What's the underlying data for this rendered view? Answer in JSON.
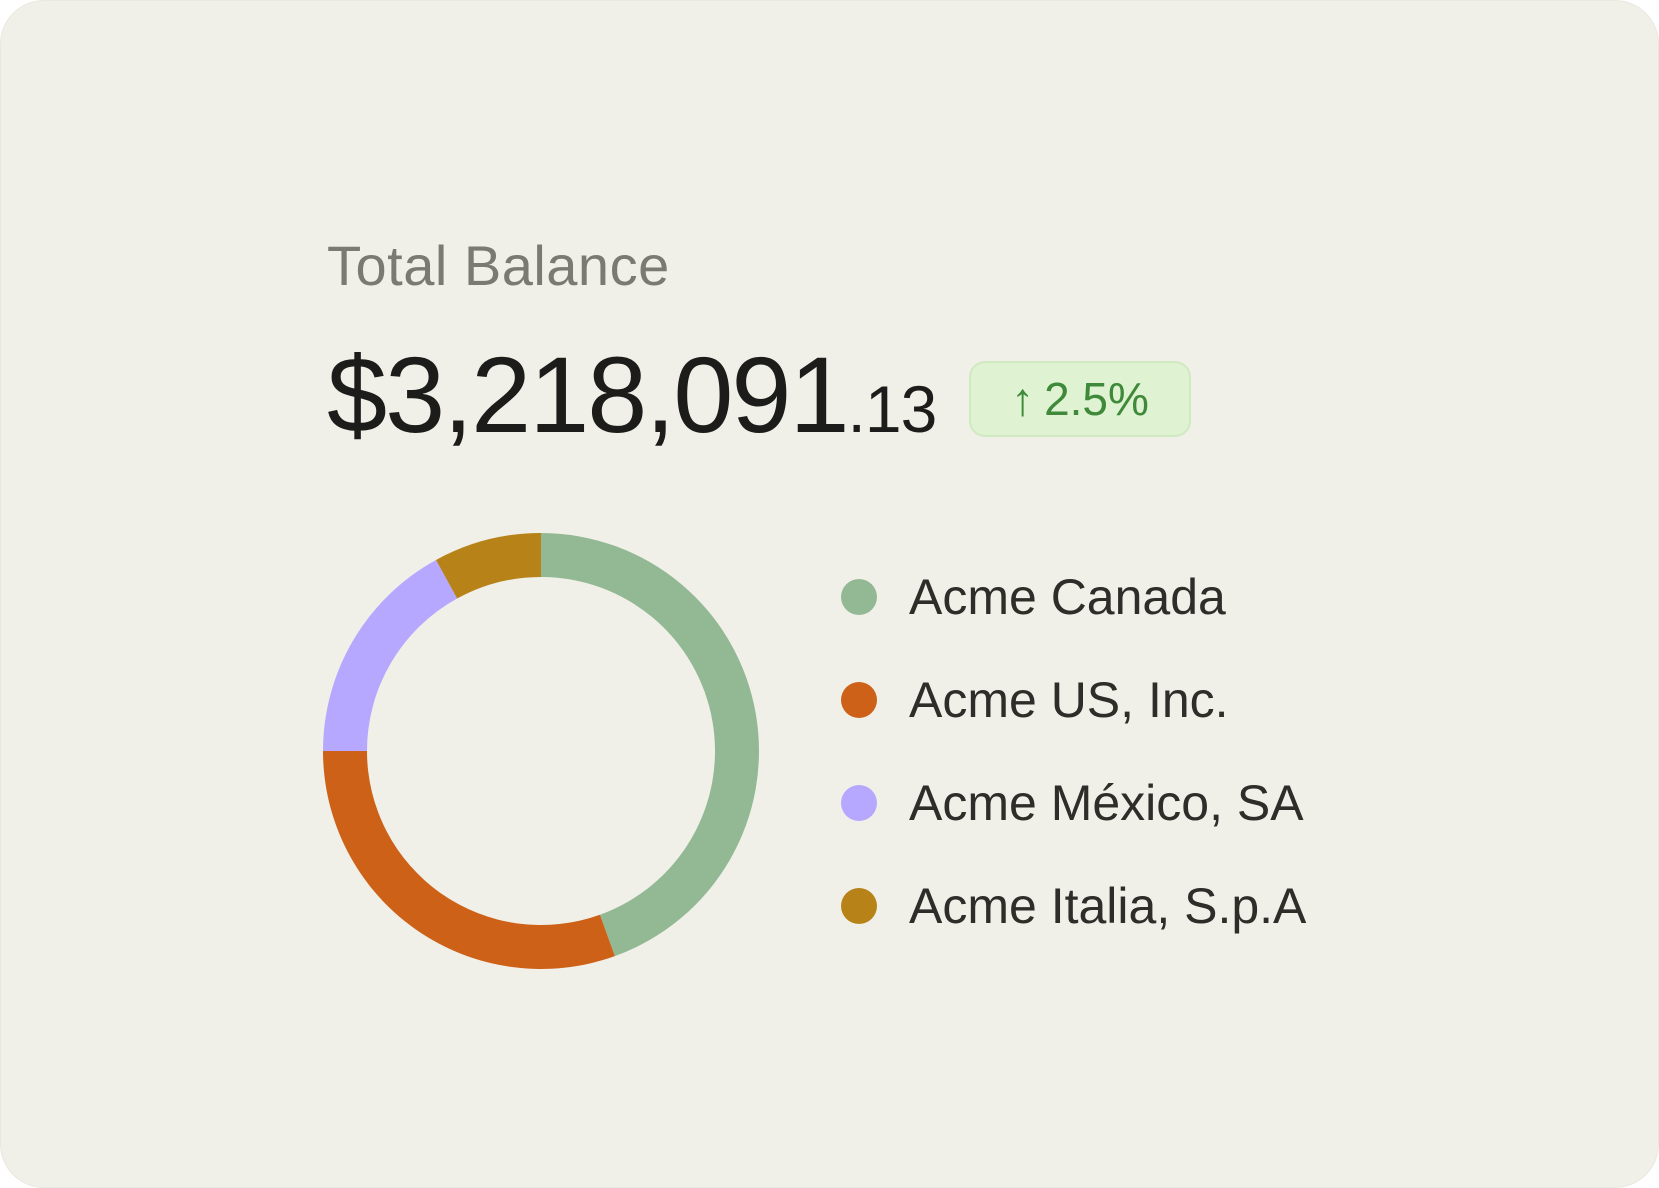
{
  "card": {
    "label": "Total Balance",
    "amount_main": "$3,218,091",
    "amount_cents": ".13",
    "change_arrow": "↑",
    "change_value": "2.5%"
  },
  "colors": {
    "background": "#f1f0e8",
    "badge_bg": "#dff2d2",
    "badge_text": "#3f8a3a"
  },
  "chart_data": {
    "type": "pie",
    "style": "donut",
    "title": "",
    "categories": [
      "Acme Canada",
      "Acme US, Inc.",
      "Acme México, SA",
      "Acme Italia, S.p.A"
    ],
    "values": [
      44.5,
      30.5,
      17.0,
      8.0
    ],
    "colors": [
      "#93b994",
      "#cd6117",
      "#b7a8ff",
      "#b78319"
    ],
    "legend_position": "right"
  }
}
